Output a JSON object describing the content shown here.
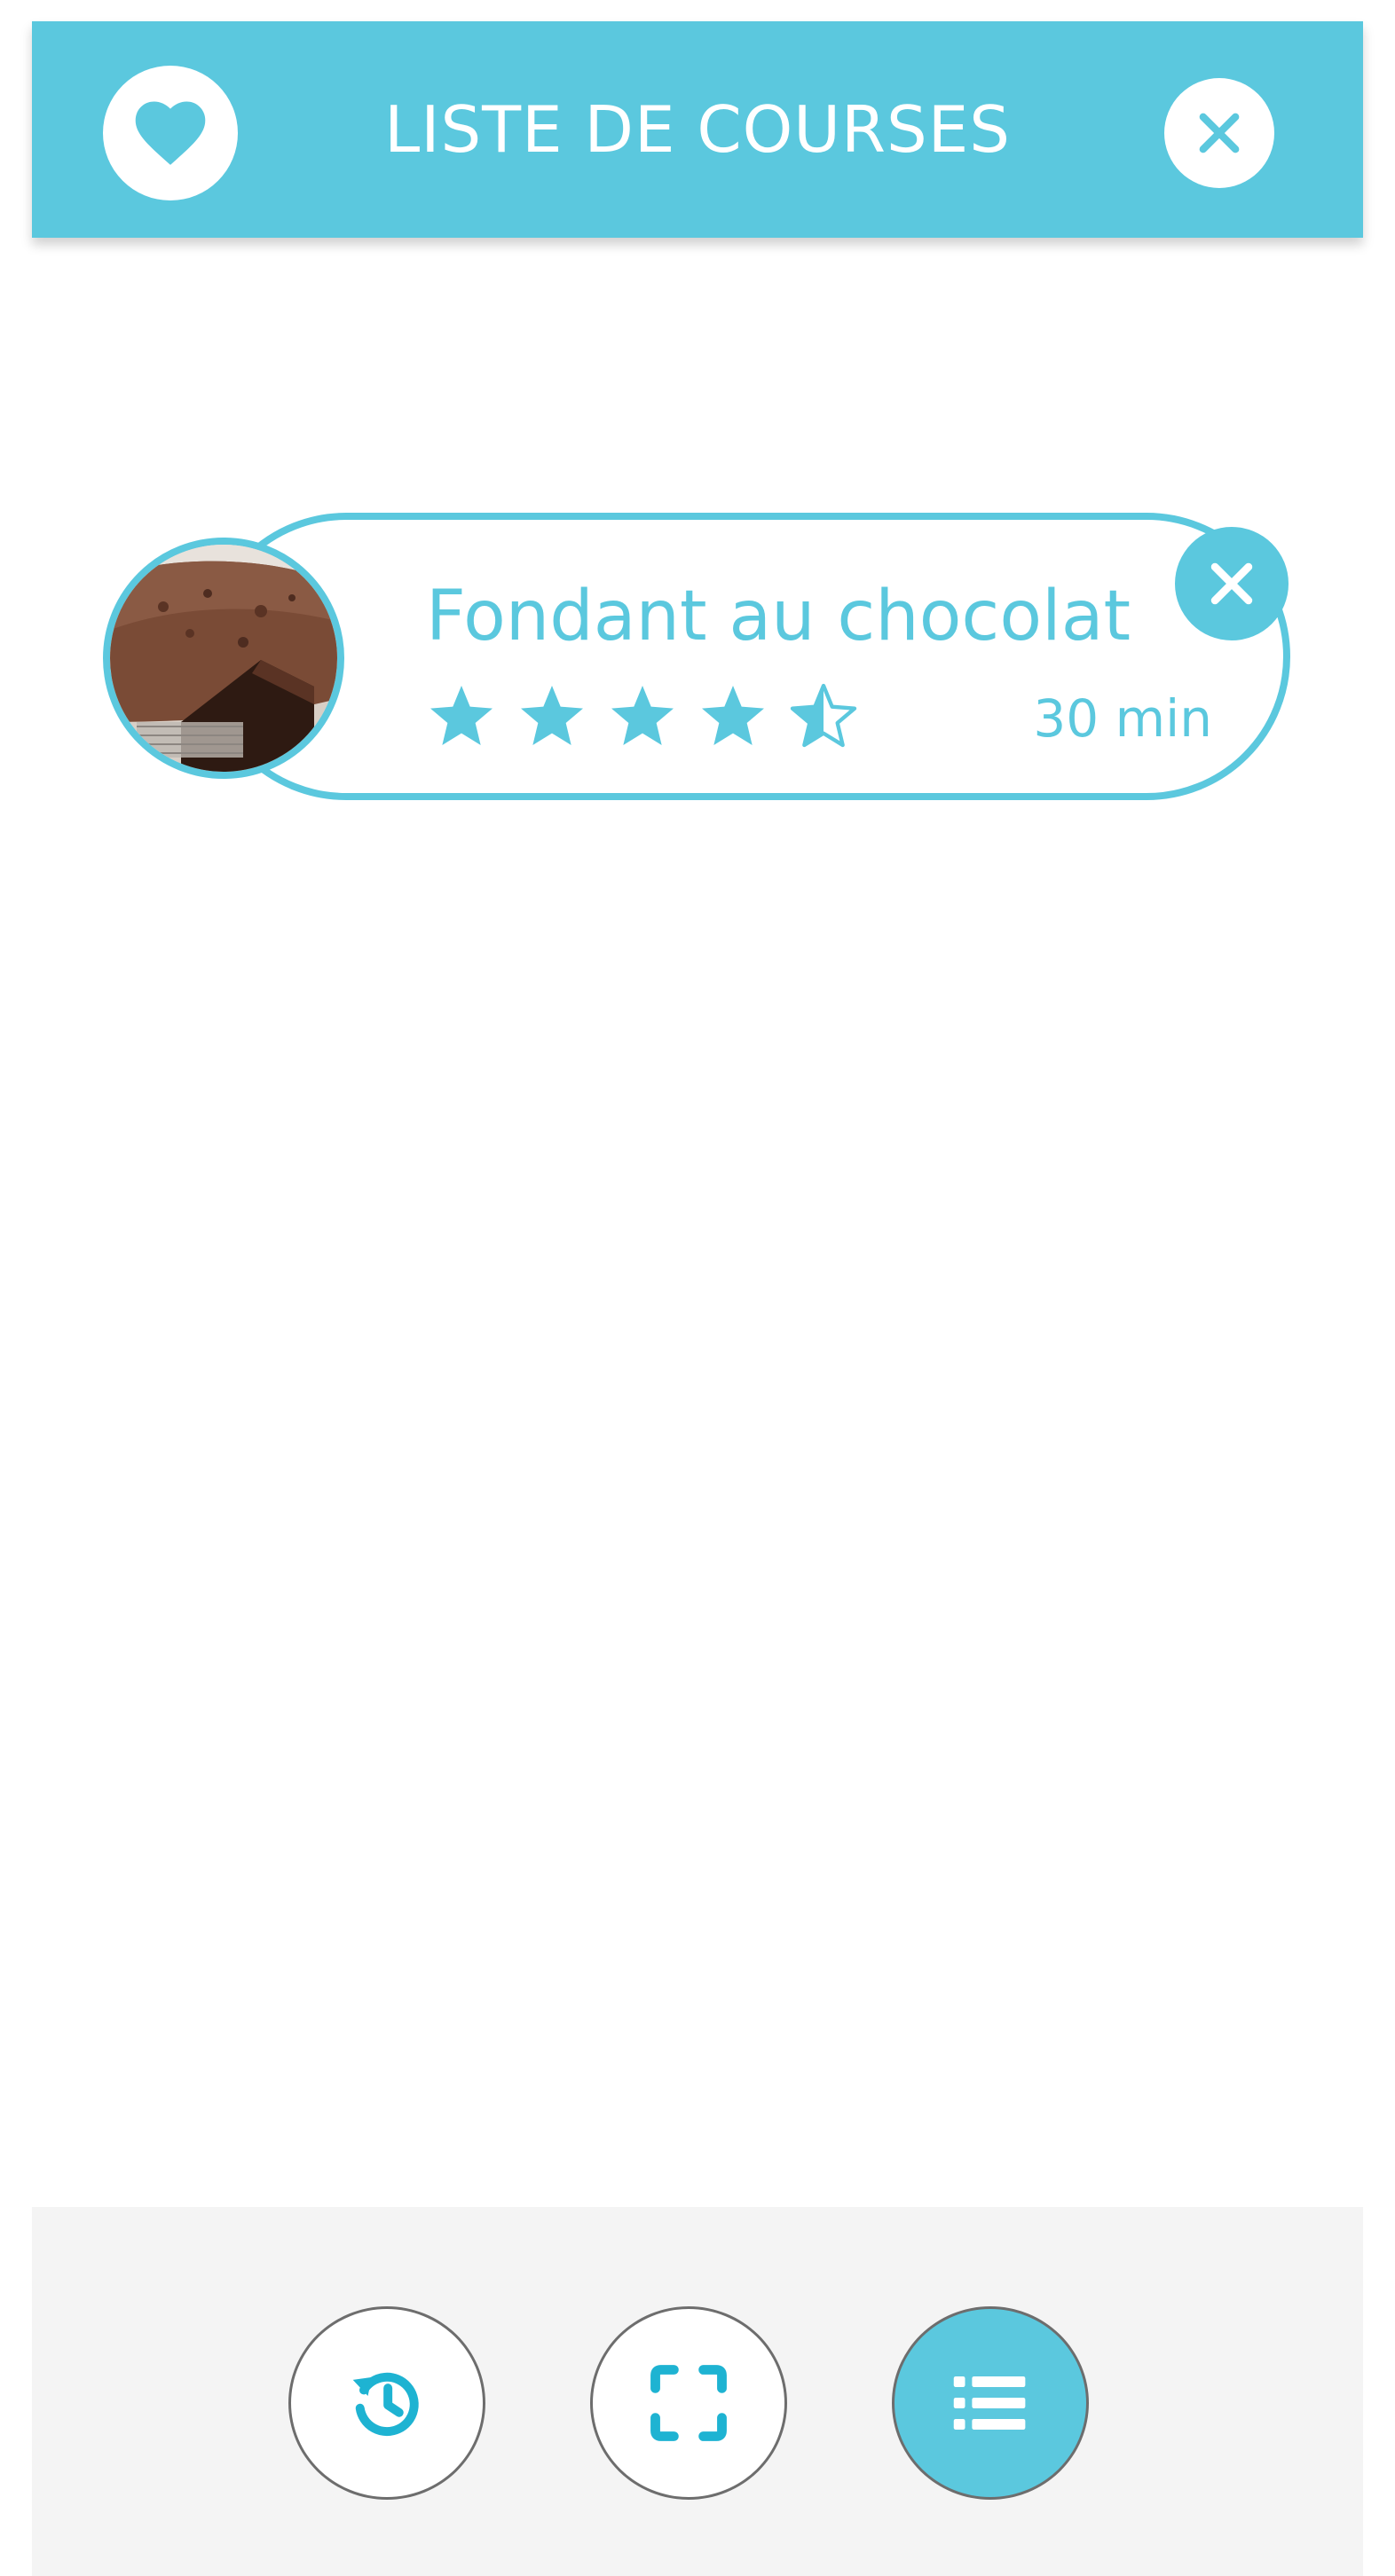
{
  "header": {
    "title": "LISTE DE COURSES",
    "favorite_icon": "heart-icon",
    "close_icon": "close-icon"
  },
  "recipe": {
    "title": "Fondant au chocolat",
    "rating": 4.5,
    "rating_max": 5,
    "duration": "30 min",
    "image_desc_icon": "chocolate-cake-photo",
    "remove_icon": "close-icon"
  },
  "bottom_nav": {
    "items": [
      {
        "icon": "history-icon",
        "active": false
      },
      {
        "icon": "scan-icon",
        "active": false
      },
      {
        "icon": "list-icon",
        "active": true
      }
    ]
  },
  "colors": {
    "accent": "#5bc8de",
    "background": "#ffffff",
    "bottom_bar": "#f4f4f4",
    "nav_border": "#6d6d6d"
  }
}
